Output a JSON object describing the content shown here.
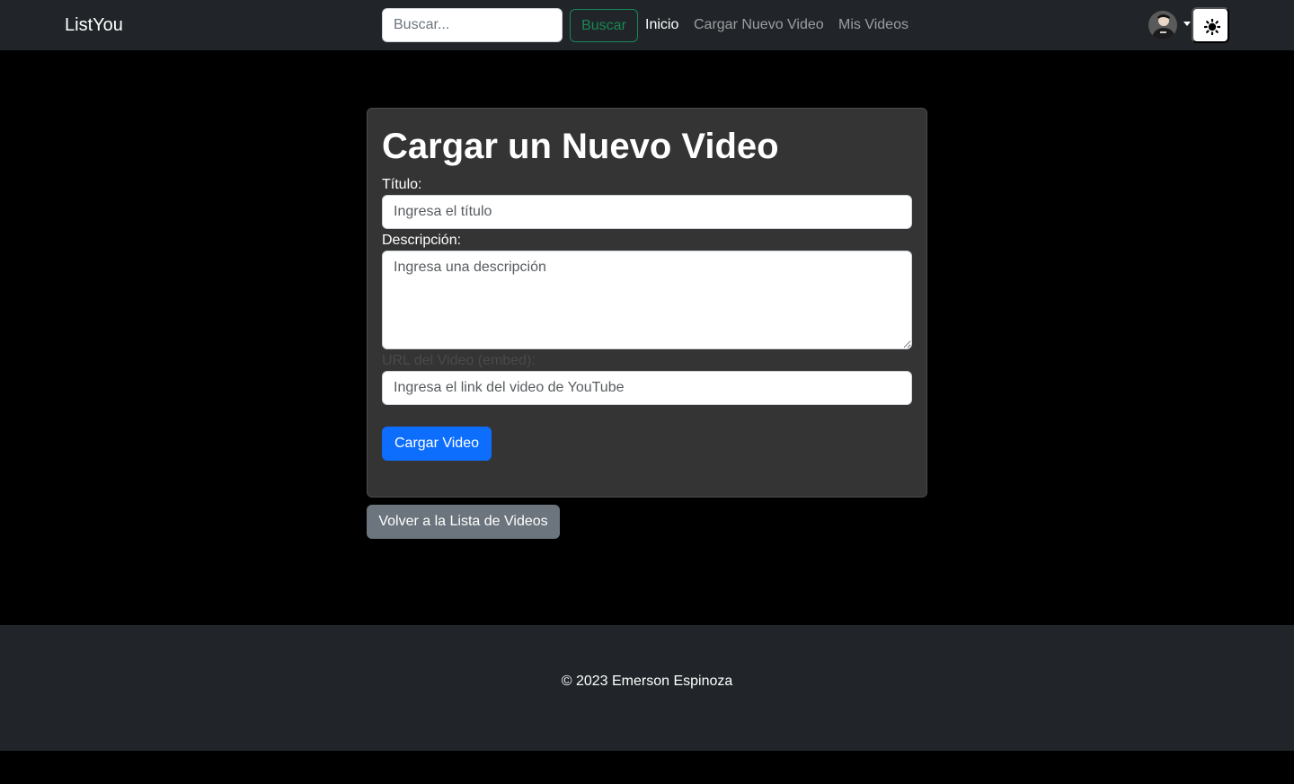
{
  "navbar": {
    "brand": "ListYou",
    "search": {
      "placeholder": "Buscar...",
      "button_label": "Buscar"
    },
    "links": [
      {
        "label": "Inicio",
        "active": true
      },
      {
        "label": "Cargar Nuevo Video",
        "active": false
      },
      {
        "label": "Mis Videos",
        "active": false
      }
    ],
    "avatar_icon": "user-avatar",
    "theme_icon": "sun-icon"
  },
  "form": {
    "title": "Cargar un Nuevo Video",
    "title_field": {
      "label": "Título:",
      "placeholder": "Ingresa el título"
    },
    "description_field": {
      "label": "Descripción:",
      "placeholder": "Ingresa una descripción"
    },
    "url_field": {
      "label": "URL del Video (embed):",
      "placeholder": "Ingresa el link del video de YouTube"
    },
    "submit_label": "Cargar Video"
  },
  "back_button_label": "Volver a la Lista de Videos",
  "footer": {
    "text": "© 2023 Emerson Espinoza"
  },
  "colors": {
    "navbar_bg": "#212529",
    "page_bg": "#000000",
    "card_bg": "#343434",
    "primary": "#0d6efd",
    "success": "#198754",
    "secondary": "#6c757d"
  }
}
